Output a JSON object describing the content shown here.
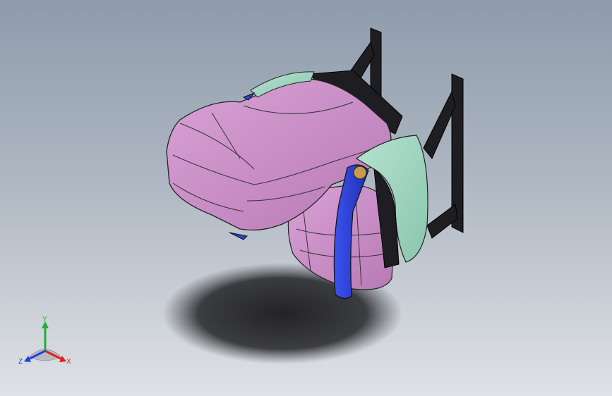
{
  "viewport": {
    "background_top": "#8e9bab",
    "background_bottom": "#dfe2e6"
  },
  "model": {
    "parts": [
      {
        "name": "seat-cushion",
        "color": "#c98ac6"
      },
      {
        "name": "seat-back",
        "color": "#c98ac6"
      },
      {
        "name": "side-bolster-trim",
        "color": "#9fd6c0"
      },
      {
        "name": "recliner-cover",
        "color": "#2d3fd6"
      },
      {
        "name": "recliner-pivot",
        "color": "#c99a4a"
      },
      {
        "name": "mounting-bracket",
        "color": "#1e1e22"
      }
    ],
    "shadow_color": "#2a2a2e"
  },
  "triad": {
    "x_label": "X",
    "y_label": "Y",
    "z_label": "Z",
    "x_color": "#e0201c",
    "y_color": "#1fb030",
    "z_color": "#2040e0"
  }
}
